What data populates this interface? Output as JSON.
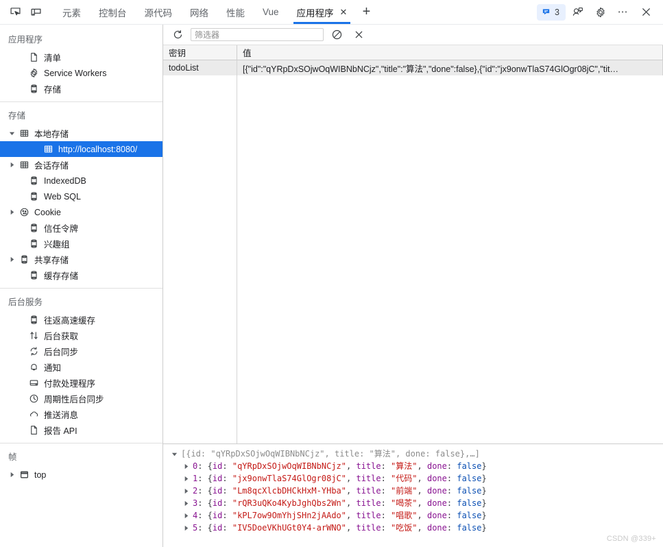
{
  "tabbar": {
    "left_icons": [
      {
        "name": "inspect-element-icon",
        "title": "检查"
      },
      {
        "name": "device-toolbar-icon",
        "title": "设备工具栏"
      }
    ],
    "tabs": [
      {
        "label": "元素",
        "active": false
      },
      {
        "label": "控制台",
        "active": false
      },
      {
        "label": "源代码",
        "active": false
      },
      {
        "label": "网络",
        "active": false
      },
      {
        "label": "性能",
        "active": false
      },
      {
        "label": "Vue",
        "active": false
      },
      {
        "label": "应用程序",
        "active": true,
        "close": "✕"
      }
    ],
    "add_tab_label": "+",
    "issues_count": "3",
    "right_icons": [
      {
        "name": "devtools-layout-icon"
      },
      {
        "name": "gear-icon"
      },
      {
        "name": "more-options-icon",
        "label": "⋯"
      },
      {
        "name": "close-icon"
      }
    ]
  },
  "sidebar": {
    "sections": [
      {
        "title": "应用程序",
        "items": [
          {
            "label": "清单",
            "icon": "document-icon",
            "indent": 1,
            "twisty": "none"
          },
          {
            "label": "Service Workers",
            "icon": "gear-icon",
            "indent": 1,
            "twisty": "none"
          },
          {
            "label": "存储",
            "icon": "database-icon",
            "indent": 1,
            "twisty": "none"
          }
        ]
      },
      {
        "title": "存储",
        "items": [
          {
            "label": "本地存储",
            "icon": "table-grid-icon",
            "indent": 0,
            "twisty": "expanded"
          },
          {
            "label": "http://localhost:8080/",
            "icon": "table-grid-icon",
            "indent": 2,
            "twisty": "none",
            "selected": true
          },
          {
            "label": "会话存储",
            "icon": "table-grid-icon",
            "indent": 0,
            "twisty": "collapsed"
          },
          {
            "label": "IndexedDB",
            "icon": "database-icon",
            "indent": 1,
            "twisty": "none"
          },
          {
            "label": "Web SQL",
            "icon": "database-icon",
            "indent": 1,
            "twisty": "none"
          },
          {
            "label": "Cookie",
            "icon": "cookie-icon",
            "indent": 0,
            "twisty": "collapsed"
          },
          {
            "label": "信任令牌",
            "icon": "database-icon",
            "indent": 1,
            "twisty": "none"
          },
          {
            "label": "兴趣组",
            "icon": "database-icon",
            "indent": 1,
            "twisty": "none"
          },
          {
            "label": "共享存储",
            "icon": "database-icon",
            "indent": 0,
            "twisty": "collapsed"
          },
          {
            "label": "缓存存储",
            "icon": "database-icon",
            "indent": 1,
            "twisty": "none"
          }
        ]
      },
      {
        "title": "后台服务",
        "items": [
          {
            "label": "往返高速缓存",
            "icon": "database-icon",
            "indent": 1,
            "twisty": "none"
          },
          {
            "label": "后台获取",
            "icon": "arrows-updown-icon",
            "indent": 1,
            "twisty": "none"
          },
          {
            "label": "后台同步",
            "icon": "sync-icon",
            "indent": 1,
            "twisty": "none"
          },
          {
            "label": "通知",
            "icon": "bell-icon",
            "indent": 1,
            "twisty": "none"
          },
          {
            "label": "付款处理程序",
            "icon": "credit-card-icon",
            "indent": 1,
            "twisty": "none"
          },
          {
            "label": "周期性后台同步",
            "icon": "clock-icon",
            "indent": 1,
            "twisty": "none"
          },
          {
            "label": "推送消息",
            "icon": "cloud-icon",
            "indent": 1,
            "twisty": "none"
          },
          {
            "label": "报告 API",
            "icon": "document-icon",
            "indent": 1,
            "twisty": "none"
          }
        ]
      },
      {
        "title": "帧",
        "items": [
          {
            "label": "top",
            "icon": "frame-icon",
            "indent": 0,
            "twisty": "collapsed"
          }
        ]
      }
    ]
  },
  "main": {
    "toolbar": {
      "refresh_icon": "refresh-icon",
      "filter_placeholder": "筛选器",
      "filter_value": "",
      "clear_all_icon": "clear-all-icon",
      "delete_selected_icon": "delete-selected-icon"
    },
    "table": {
      "columns": [
        "密钥",
        "值"
      ],
      "rows": [
        {
          "key": "todoList",
          "value": "[{\"id\":\"qYRpDxSOjwOqWIBNbNCjz\",\"title\":\"算法\",\"done\":false},{\"id\":\"jx9onwTlaS74GlOgr08jC\",\"tit…"
        }
      ]
    },
    "preview": {
      "root": {
        "arrow": "expanded",
        "text": "[{id: \"qYRpDxSOjwOqWIBNbNCjz\", title: \"算法\", done: false},…]"
      },
      "items": [
        {
          "index": "0",
          "id": "qYRpDxSOjwOqWIBNbNCjz",
          "title": "算法",
          "done": "false"
        },
        {
          "index": "1",
          "id": "jx9onwTlaS74GlOgr08jC",
          "title": "代码",
          "done": "false"
        },
        {
          "index": "2",
          "id": "Lm8qcXlcbDHCkHxM-YHba",
          "title": "前端",
          "done": "false"
        },
        {
          "index": "3",
          "id": "rQR3uQKo4KybJghQbs2Wn",
          "title": "喝茶",
          "done": "false"
        },
        {
          "index": "4",
          "id": "kPL7ow9OmYhjSHn2jAAdo",
          "title": "唱歌",
          "done": "false"
        },
        {
          "index": "5",
          "id": "IV5DoeVKhUGt0Y4-arWNO",
          "title": "吃饭",
          "done": "false"
        }
      ]
    }
  },
  "watermark": "CSDN @339+",
  "colors": {
    "accent": "#1a73e8",
    "selected_row_bg": "#1a73e8",
    "table_row_bg": "#ebebeb",
    "string_color": "#c41a16",
    "key_color": "#881391",
    "bool_color": "#0b4fb3"
  }
}
